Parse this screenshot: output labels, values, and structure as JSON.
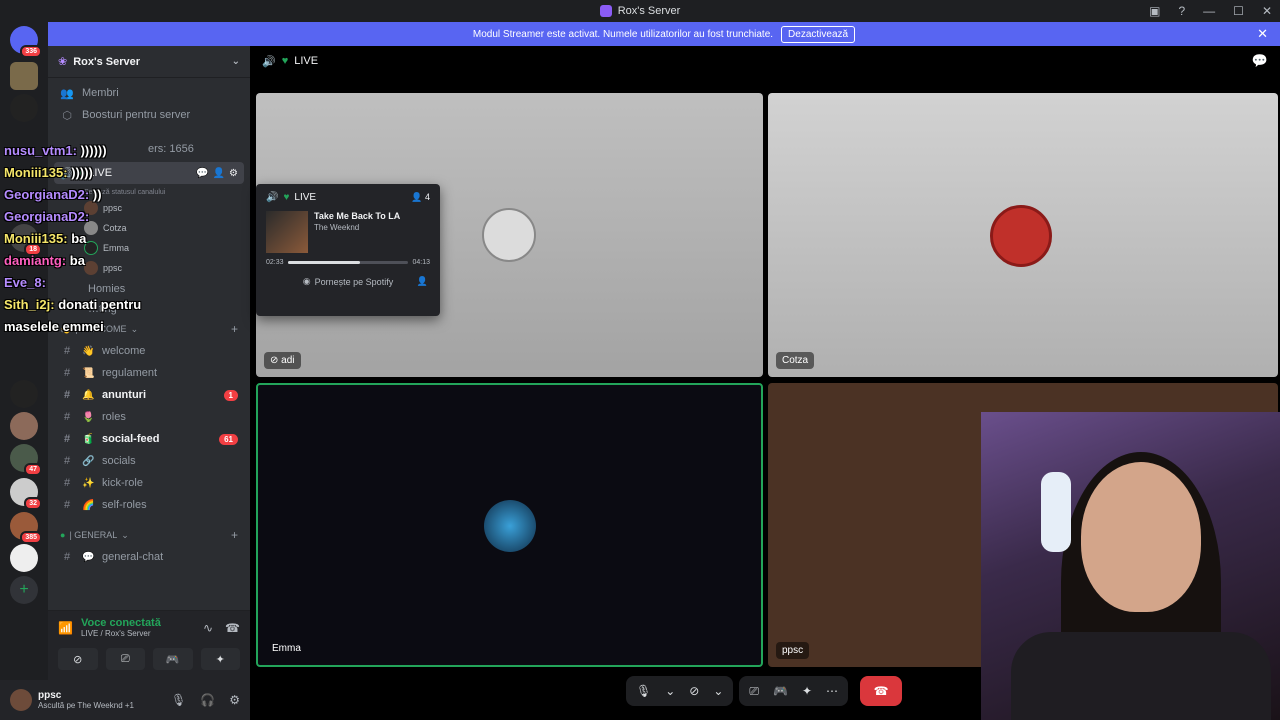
{
  "window": {
    "title": "Rox's Server",
    "controls": [
      "—",
      "☐",
      "✕"
    ]
  },
  "banner": {
    "text": "Modul Streamer este activat. Numele utilizatorilor au fost trunchiate.",
    "button": "Dezactivează"
  },
  "guilds": {
    "badges": [
      "336",
      "18",
      "47",
      "32",
      "385"
    ]
  },
  "sidebar": {
    "server_name": "Rox's Server",
    "top_items": [
      "Membri",
      "Boosturi pentru server"
    ],
    "members_count_text": "ers: 1656",
    "live_channel": {
      "name": "LIVE",
      "status_hint": "Setează statusul canalului"
    },
    "voice_users": [
      "ppsc",
      "Cotza",
      "Emma",
      "ppsc"
    ],
    "sub_channels": [
      "Homies",
      "…ting"
    ],
    "categories": [
      {
        "name": "| WELCOME",
        "channels": [
          {
            "icon": "👋",
            "name": "welcome",
            "bright": false
          },
          {
            "icon": "📜",
            "name": "regulament",
            "bright": false
          },
          {
            "icon": "🔔",
            "name": "anunturi",
            "bright": true,
            "badge": "1"
          },
          {
            "icon": "🌷",
            "name": "roles",
            "bright": false
          },
          {
            "icon": "🧃",
            "name": "social-feed",
            "bright": true,
            "badge": "61"
          },
          {
            "icon": "🔗",
            "name": "socials",
            "bright": false
          },
          {
            "icon": "✨",
            "name": "kick-role",
            "bright": false
          },
          {
            "icon": "🌈",
            "name": "self-roles",
            "bright": false
          }
        ]
      },
      {
        "name": "| GENERAL",
        "channels": [
          {
            "icon": "💬",
            "name": "general-chat",
            "bright": false
          }
        ]
      }
    ]
  },
  "chat_overlay": [
    {
      "name": "nusu_vtm1:",
      "message": "))))))"
    },
    {
      "name": "Moniii135:",
      "message": ")))))"
    },
    {
      "name": "GeorgianaD2:",
      "message": "))"
    },
    {
      "name": "GeorgianaD2:",
      "message": ""
    },
    {
      "name": "Moniii135:",
      "message": "ba"
    },
    {
      "name": "damiantg:",
      "message": "ba"
    },
    {
      "name": "Eve_8:",
      "message": ""
    },
    {
      "name": "Sith_i2j:",
      "message": "donati pentru"
    },
    {
      "name": "",
      "message": "maselele emmei"
    }
  ],
  "voice_panel": {
    "status": "Voce conectată",
    "channel": "LIVE / Rox's Server"
  },
  "user_panel": {
    "name": "ppsc",
    "status": "Ascultă pe The Weeknd +1"
  },
  "stage": {
    "channel_name": "LIVE",
    "tiles": [
      "adi",
      "Cotza",
      "Emma",
      "ppsc"
    ]
  },
  "popup": {
    "channel": "LIVE",
    "count": "4",
    "song": "Take Me Back To LA",
    "artist": "The Weeknd",
    "elapsed": "02:33",
    "duration": "04:13",
    "progress": 0.6,
    "spotify_button": "Pornește pe Spotify"
  }
}
